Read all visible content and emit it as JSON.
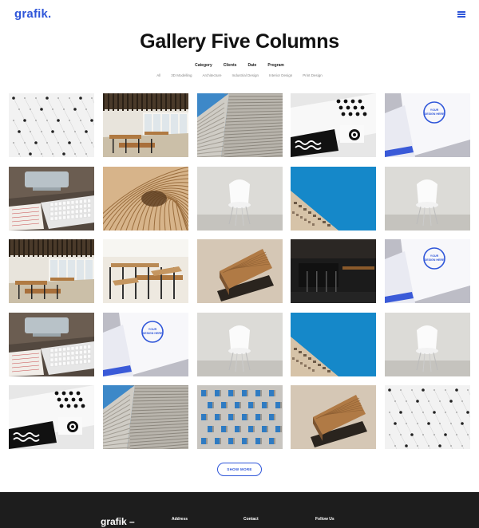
{
  "header": {
    "logo": "grafik."
  },
  "page": {
    "title": "Gallery Five Columns"
  },
  "filters": {
    "groups": [
      "Category",
      "Clients",
      "Date",
      "Program"
    ],
    "tags": [
      "All",
      "3D Modelling",
      "Architecture",
      "Industrial Design",
      "Interior Design",
      "Print Design"
    ]
  },
  "gallery": {
    "tiles": [
      "dots-pattern",
      "restaurant",
      "building-stripes",
      "cards-dots",
      "business-card",
      "keyboard-desk",
      "wood-curves",
      "white-chair",
      "blue-sky-building",
      "white-chair",
      "restaurant",
      "restaurant-chairs",
      "wood-blocks",
      "dark-interior",
      "business-card",
      "keyboard-desk",
      "business-card",
      "white-chair",
      "blue-sky-building",
      "white-chair",
      "cards-dots",
      "building-stripes",
      "building-windows",
      "wood-blocks",
      "dots-pattern"
    ]
  },
  "show_more": "SHOW MORE",
  "footer": {
    "brand": "grafik –",
    "headings": {
      "address": "Address",
      "contact": "Contact",
      "follow": "Follow Us"
    }
  },
  "colors": {
    "accent": "#2f56d9",
    "footer_bg": "#1d1d1d"
  }
}
